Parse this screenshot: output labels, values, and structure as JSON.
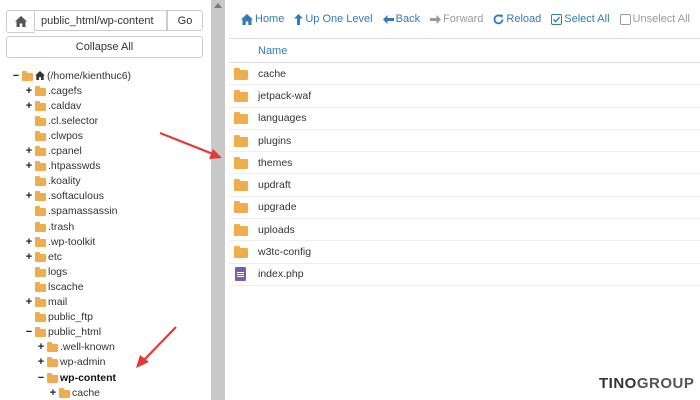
{
  "tree_header": {
    "path_value": "public_html/wp-content",
    "go_label": "Go",
    "collapse_label": "Collapse All"
  },
  "tree": [
    {
      "label": "(/home/kienthuc6)",
      "toggle": "−",
      "icon": "folder",
      "home": true,
      "level": 0,
      "bold": false
    },
    {
      "label": ".cagefs",
      "toggle": "+",
      "level": 1,
      "bold": false
    },
    {
      "label": ".caldav",
      "toggle": "+",
      "level": 1,
      "bold": false
    },
    {
      "label": ".cl.selector",
      "toggle": "",
      "level": 1,
      "bold": false
    },
    {
      "label": ".clwpos",
      "toggle": "",
      "level": 1,
      "bold": false
    },
    {
      "label": ".cpanel",
      "toggle": "+",
      "level": 1,
      "bold": false
    },
    {
      "label": ".htpasswds",
      "toggle": "+",
      "level": 1,
      "bold": false
    },
    {
      "label": ".koality",
      "toggle": "",
      "level": 1,
      "bold": false
    },
    {
      "label": ".softaculous",
      "toggle": "+",
      "level": 1,
      "bold": false
    },
    {
      "label": ".spamassassin",
      "toggle": "",
      "level": 1,
      "bold": false
    },
    {
      "label": ".trash",
      "toggle": "",
      "level": 1,
      "bold": false
    },
    {
      "label": ".wp-toolkit",
      "toggle": "+",
      "level": 1,
      "bold": false
    },
    {
      "label": "etc",
      "toggle": "+",
      "level": 1,
      "bold": false
    },
    {
      "label": "logs",
      "toggle": "",
      "level": 1,
      "bold": false
    },
    {
      "label": "lscache",
      "toggle": "",
      "level": 1,
      "bold": false
    },
    {
      "label": "mail",
      "toggle": "+",
      "level": 1,
      "bold": false
    },
    {
      "label": "public_ftp",
      "toggle": "",
      "level": 1,
      "bold": false
    },
    {
      "label": "public_html",
      "toggle": "−",
      "level": 1,
      "bold": false
    },
    {
      "label": ".well-known",
      "toggle": "+",
      "level": 2,
      "bold": false
    },
    {
      "label": "wp-admin",
      "toggle": "+",
      "level": 2,
      "bold": false
    },
    {
      "label": "wp-content",
      "toggle": "−",
      "level": 2,
      "bold": true
    },
    {
      "label": "cache",
      "toggle": "+",
      "level": 3,
      "bold": false
    }
  ],
  "toolbar": {
    "home": "Home",
    "up": "Up One Level",
    "back": "Back",
    "forward": "Forward",
    "reload": "Reload",
    "select_all": "Select All",
    "unselect_all": "Unselect All"
  },
  "file_list": {
    "column_name": "Name",
    "rows": [
      {
        "name": "cache",
        "type": "folder"
      },
      {
        "name": "jetpack-waf",
        "type": "folder"
      },
      {
        "name": "languages",
        "type": "folder"
      },
      {
        "name": "plugins",
        "type": "folder"
      },
      {
        "name": "themes",
        "type": "folder"
      },
      {
        "name": "updraft",
        "type": "folder"
      },
      {
        "name": "upgrade",
        "type": "folder"
      },
      {
        "name": "uploads",
        "type": "folder"
      },
      {
        "name": "w3tc-config",
        "type": "folder"
      },
      {
        "name": "index.php",
        "type": "php"
      }
    ]
  },
  "brand": {
    "part1": "TINO",
    "part2": "GROUP"
  },
  "colors": {
    "link": "#337ab7",
    "folder": "#f0ad4e",
    "php_file": "#7b5ea7",
    "annotation_arrow": "#e53935"
  }
}
